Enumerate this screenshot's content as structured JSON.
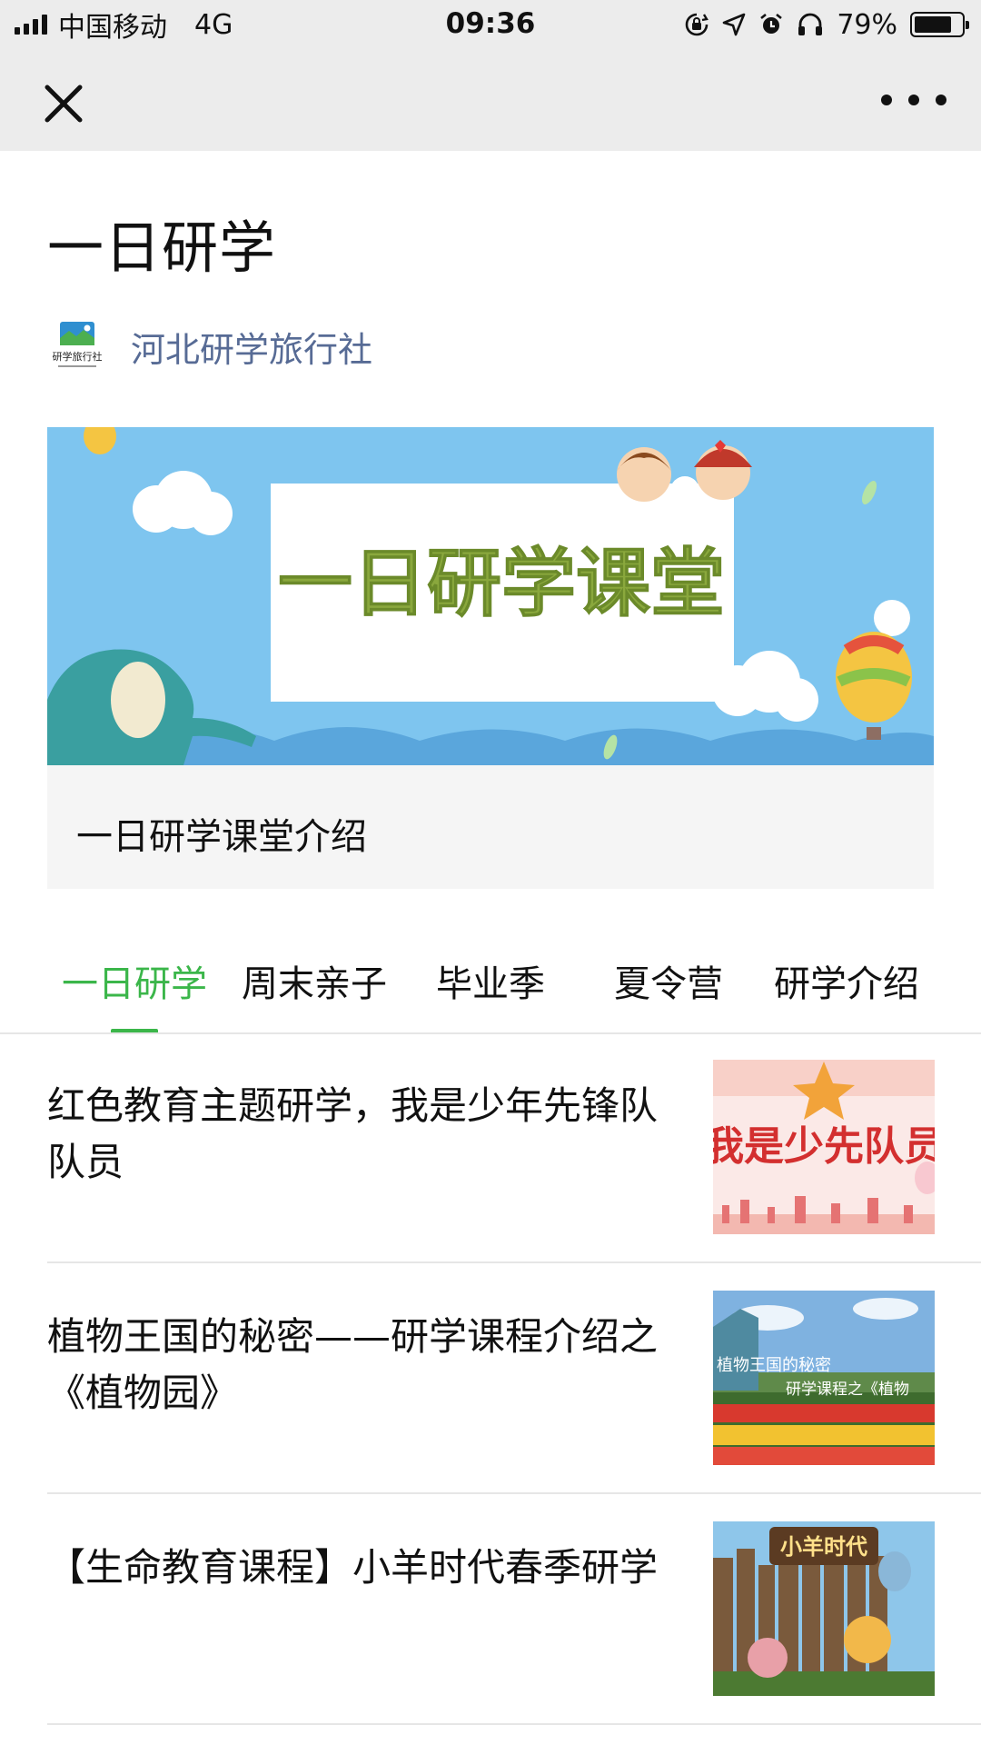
{
  "status_bar": {
    "carrier": "中国移动",
    "network": "4G",
    "time": "09:36",
    "battery_level": 0.79,
    "battery": "79%",
    "icons": [
      "signal-icon",
      "orientation-lock-icon",
      "location-icon",
      "alarm-icon",
      "headphones-icon",
      "battery-icon"
    ]
  },
  "nav": {
    "close_icon": "close-icon",
    "more_icon": "more-icon"
  },
  "article_header": {
    "title": "一日研学",
    "account_name": "河北研学旅行社",
    "account_logo_text": "研学旅行社"
  },
  "banner": {
    "image_text": "一日研学课堂",
    "caption": "一日研学课堂介绍"
  },
  "tabs": [
    {
      "label": "一日研学",
      "active": true
    },
    {
      "label": "周末亲子",
      "active": false
    },
    {
      "label": "毕业季",
      "active": false
    },
    {
      "label": "夏令营",
      "active": false
    },
    {
      "label": "研学介绍",
      "active": false
    }
  ],
  "articles": [
    {
      "title": "红色教育主题研学，我是少年先锋队队员",
      "thumb_text": "我是少先队员"
    },
    {
      "title": "植物王国的秘密——研学课程介绍之《植物园》",
      "thumb_text_1": "植物王国的秘密",
      "thumb_text_2": "研学课程之《植物"
    },
    {
      "title": "【生命教育课程】小羊时代春季研学",
      "thumb_text": "小羊时代"
    }
  ],
  "colors": {
    "accent_green": "#3bb64a",
    "link_blue": "#576b95",
    "bar_gray": "#ececec"
  }
}
